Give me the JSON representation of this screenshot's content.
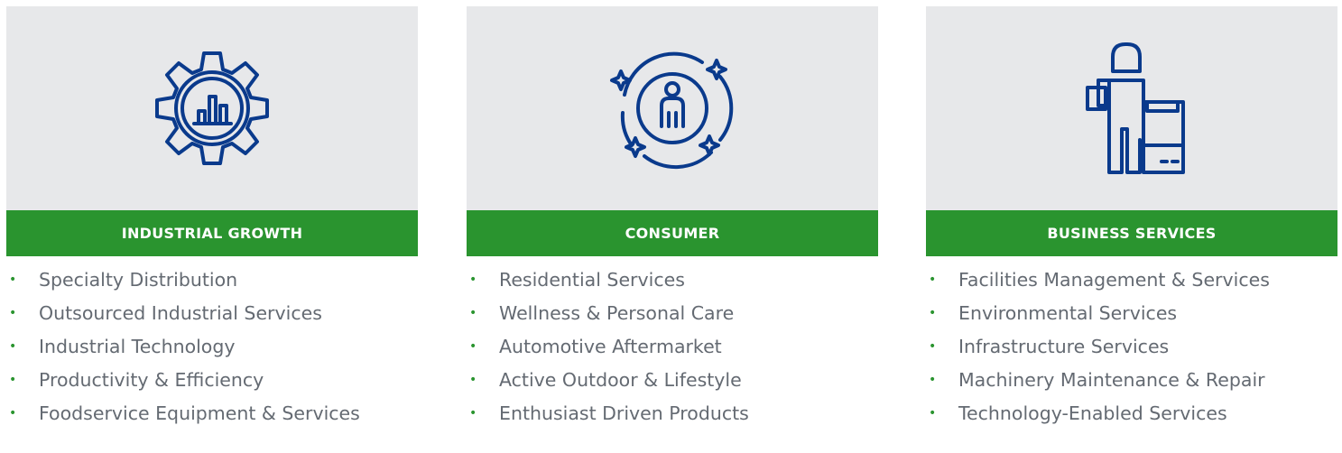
{
  "colors": {
    "panel_bg": "#e7e8ea",
    "header_green": "#2a942f",
    "icon_blue": "#0a3a8c",
    "text_gray": "#646a72"
  },
  "columns": [
    {
      "icon": "gear-chart-icon",
      "title": "INDUSTRIAL GROWTH",
      "items": [
        "Specialty Distribution",
        "Outsourced Industrial Services",
        "Industrial Technology",
        "Productivity & Efficiency",
        "Foodservice Equipment & Services"
      ]
    },
    {
      "icon": "person-sparkle-icon",
      "title": "CONSUMER",
      "items": [
        "Residential Services",
        "Wellness & Personal Care",
        "Automotive Aftermarket",
        "Active Outdoor & Lifestyle",
        "Enthusiast Driven Products"
      ]
    },
    {
      "icon": "person-box-icon",
      "title": "BUSINESS SERVICES",
      "items": [
        "Facilities Management & Services",
        "Environmental Services",
        "Infrastructure Services",
        "Machinery Maintenance & Repair",
        "Technology-Enabled Services"
      ]
    }
  ]
}
